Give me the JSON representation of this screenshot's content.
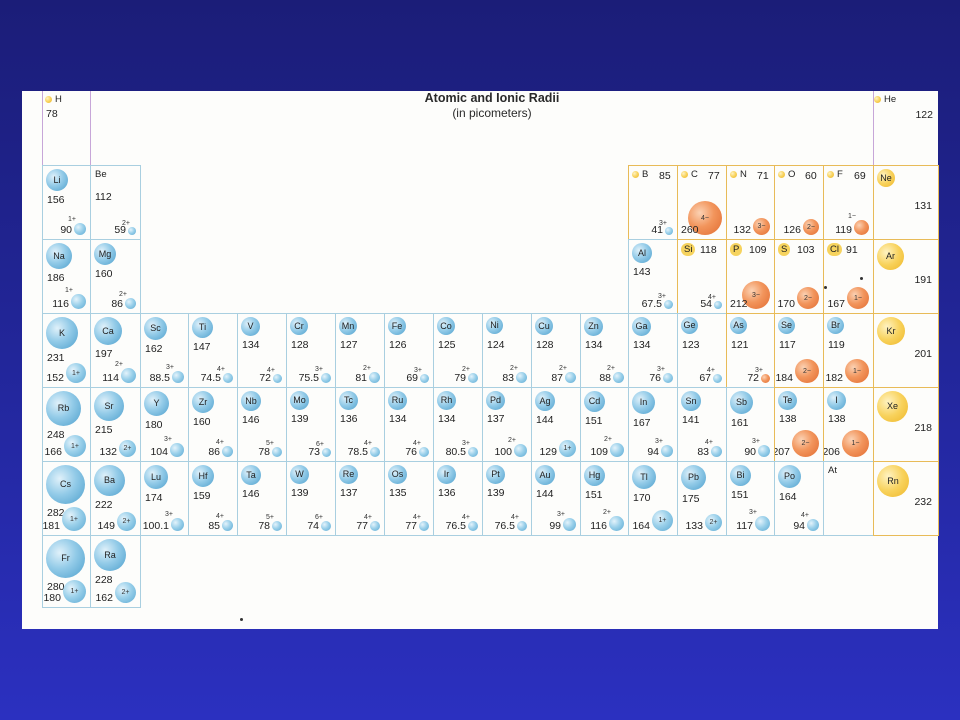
{
  "title": "Atomic and Ionic Radii",
  "subtitle": "(in picometers)",
  "colors": {
    "background": "#22269a",
    "cation": "#6db4dc",
    "anion": "#f08a52",
    "noble_gas": "#f5cf55",
    "cell_border": "#a9cfe0"
  },
  "elements": [
    {
      "symbol": "H",
      "atomic_radius": "78",
      "style": "small"
    },
    {
      "symbol": "He",
      "atomic_radius": "122",
      "style": "small-right"
    },
    {
      "symbol": "Li",
      "atomic_radius": "156",
      "ion_radius": "90",
      "charge": "1+",
      "ion_type": "cation"
    },
    {
      "symbol": "Be",
      "atomic_radius": "112",
      "ion_radius": "59",
      "charge": "2+",
      "ion_type": "cation",
      "style": "text"
    },
    {
      "symbol": "B",
      "atomic_radius": "85",
      "ion_radius": "41",
      "charge": "3+",
      "ion_type": "cation",
      "style": "small"
    },
    {
      "symbol": "C",
      "atomic_radius": "77",
      "ion_radius": "260",
      "charge": "4−",
      "ion_type": "anion",
      "style": "small"
    },
    {
      "symbol": "N",
      "atomic_radius": "71",
      "ion_radius": "132",
      "charge": "3−",
      "ion_type": "anion",
      "style": "small"
    },
    {
      "symbol": "O",
      "atomic_radius": "60",
      "ion_radius": "126",
      "charge": "2−",
      "ion_type": "anion",
      "style": "small"
    },
    {
      "symbol": "F",
      "atomic_radius": "69",
      "ion_radius": "119",
      "charge": "1−",
      "ion_type": "anion",
      "style": "small"
    },
    {
      "symbol": "Ne",
      "atomic_radius": "131",
      "style": "noble"
    },
    {
      "symbol": "Na",
      "atomic_radius": "186",
      "ion_radius": "116",
      "charge": "1+",
      "ion_type": "cation"
    },
    {
      "symbol": "Mg",
      "atomic_radius": "160",
      "ion_radius": "86",
      "charge": "2+",
      "ion_type": "cation"
    },
    {
      "symbol": "Al",
      "atomic_radius": "143",
      "ion_radius": "67.5",
      "charge": "3+",
      "ion_type": "cation"
    },
    {
      "symbol": "Si",
      "atomic_radius": "118",
      "ion_radius": "54",
      "charge": "4+",
      "ion_type": "cation",
      "style": "inline"
    },
    {
      "symbol": "P",
      "atomic_radius": "109",
      "ion_radius": "212",
      "charge": "3−",
      "ion_type": "anion",
      "style": "inline"
    },
    {
      "symbol": "S",
      "atomic_radius": "103",
      "ion_radius": "170",
      "charge": "2−",
      "ion_type": "anion",
      "style": "inline"
    },
    {
      "symbol": "Cl",
      "atomic_radius": "91",
      "ion_radius": "167",
      "charge": "1−",
      "ion_type": "anion",
      "style": "inline"
    },
    {
      "symbol": "Ar",
      "atomic_radius": "191",
      "style": "noble"
    },
    {
      "symbol": "K",
      "atomic_radius": "231",
      "ion_radius": "152",
      "charge": "1+",
      "ion_type": "cation"
    },
    {
      "symbol": "Ca",
      "atomic_radius": "197",
      "ion_radius": "114",
      "charge": "2+",
      "ion_type": "cation"
    },
    {
      "symbol": "Sc",
      "atomic_radius": "162",
      "ion_radius": "88.5",
      "charge": "3+",
      "ion_type": "cation"
    },
    {
      "symbol": "Ti",
      "atomic_radius": "147",
      "ion_radius": "74.5",
      "charge": "4+",
      "ion_type": "cation"
    },
    {
      "symbol": "V",
      "atomic_radius": "134",
      "ion_radius": "72",
      "charge": "4+",
      "ion_type": "cation"
    },
    {
      "symbol": "Cr",
      "atomic_radius": "128",
      "ion_radius": "75.5",
      "charge": "3+",
      "ion_type": "cation"
    },
    {
      "symbol": "Mn",
      "atomic_radius": "127",
      "ion_radius": "81",
      "charge": "2+",
      "ion_type": "cation"
    },
    {
      "symbol": "Fe",
      "atomic_radius": "126",
      "ion_radius": "69",
      "charge": "3+",
      "ion_type": "cation"
    },
    {
      "symbol": "Co",
      "atomic_radius": "125",
      "ion_radius": "79",
      "charge": "2+",
      "ion_type": "cation"
    },
    {
      "symbol": "Ni",
      "atomic_radius": "124",
      "ion_radius": "83",
      "charge": "2+",
      "ion_type": "cation"
    },
    {
      "symbol": "Cu",
      "atomic_radius": "128",
      "ion_radius": "87",
      "charge": "2+",
      "ion_type": "cation"
    },
    {
      "symbol": "Zn",
      "atomic_radius": "134",
      "ion_radius": "88",
      "charge": "2+",
      "ion_type": "cation"
    },
    {
      "symbol": "Ga",
      "atomic_radius": "134",
      "ion_radius": "76",
      "charge": "3+",
      "ion_type": "cation"
    },
    {
      "symbol": "Ge",
      "atomic_radius": "123",
      "ion_radius": "67",
      "charge": "4+",
      "ion_type": "cation"
    },
    {
      "symbol": "As",
      "atomic_radius": "121",
      "ion_radius": "72",
      "charge": "3+",
      "ion_type": "anion"
    },
    {
      "symbol": "Se",
      "atomic_radius": "117",
      "ion_radius": "184",
      "charge": "2−",
      "ion_type": "anion"
    },
    {
      "symbol": "Br",
      "atomic_radius": "119",
      "ion_radius": "182",
      "charge": "1−",
      "ion_type": "anion"
    },
    {
      "symbol": "Kr",
      "atomic_radius": "201",
      "style": "noble"
    },
    {
      "symbol": "Rb",
      "atomic_radius": "248",
      "ion_radius": "166",
      "charge": "1+",
      "ion_type": "cation"
    },
    {
      "symbol": "Sr",
      "atomic_radius": "215",
      "ion_radius": "132",
      "charge": "2+",
      "ion_type": "cation"
    },
    {
      "symbol": "Y",
      "atomic_radius": "180",
      "ion_radius": "104",
      "charge": "3+",
      "ion_type": "cation"
    },
    {
      "symbol": "Zr",
      "atomic_radius": "160",
      "ion_radius": "86",
      "charge": "4+",
      "ion_type": "cation"
    },
    {
      "symbol": "Nb",
      "atomic_radius": "146",
      "ion_radius": "78",
      "charge": "5+",
      "ion_type": "cation"
    },
    {
      "symbol": "Mo",
      "atomic_radius": "139",
      "ion_radius": "73",
      "charge": "6+",
      "ion_type": "cation"
    },
    {
      "symbol": "Tc",
      "atomic_radius": "136",
      "ion_radius": "78.5",
      "charge": "4+",
      "ion_type": "cation"
    },
    {
      "symbol": "Ru",
      "atomic_radius": "134",
      "ion_radius": "76",
      "charge": "4+",
      "ion_type": "cation"
    },
    {
      "symbol": "Rh",
      "atomic_radius": "134",
      "ion_radius": "80.5",
      "charge": "3+",
      "ion_type": "cation"
    },
    {
      "symbol": "Pd",
      "atomic_radius": "137",
      "ion_radius": "100",
      "charge": "2+",
      "ion_type": "cation"
    },
    {
      "symbol": "Ag",
      "atomic_radius": "144",
      "ion_radius": "129",
      "charge": "1+",
      "ion_type": "cation"
    },
    {
      "symbol": "Cd",
      "atomic_radius": "151",
      "ion_radius": "109",
      "charge": "2+",
      "ion_type": "cation"
    },
    {
      "symbol": "In",
      "atomic_radius": "167",
      "ion_radius": "94",
      "charge": "3+",
      "ion_type": "cation"
    },
    {
      "symbol": "Sn",
      "atomic_radius": "141",
      "ion_radius": "83",
      "charge": "4+",
      "ion_type": "cation"
    },
    {
      "symbol": "Sb",
      "atomic_radius": "161",
      "ion_radius": "90",
      "charge": "3+",
      "ion_type": "cation"
    },
    {
      "symbol": "Te",
      "atomic_radius": "138",
      "ion_radius": "207",
      "charge": "2−",
      "ion_type": "anion"
    },
    {
      "symbol": "I",
      "atomic_radius": "138",
      "ion_radius": "206",
      "charge": "1−",
      "ion_type": "anion"
    },
    {
      "symbol": "Xe",
      "atomic_radius": "218",
      "style": "noble"
    },
    {
      "symbol": "Cs",
      "atomic_radius": "282",
      "ion_radius": "181",
      "charge": "1+",
      "ion_type": "cation"
    },
    {
      "symbol": "Ba",
      "atomic_radius": "222",
      "ion_radius": "149",
      "charge": "2+",
      "ion_type": "cation"
    },
    {
      "symbol": "Lu",
      "atomic_radius": "174",
      "ion_radius": "100.1",
      "charge": "3+",
      "ion_type": "cation"
    },
    {
      "symbol": "Hf",
      "atomic_radius": "159",
      "ion_radius": "85",
      "charge": "4+",
      "ion_type": "cation"
    },
    {
      "symbol": "Ta",
      "atomic_radius": "146",
      "ion_radius": "78",
      "charge": "5+",
      "ion_type": "cation"
    },
    {
      "symbol": "W",
      "atomic_radius": "139",
      "ion_radius": "74",
      "charge": "6+",
      "ion_type": "cation"
    },
    {
      "symbol": "Re",
      "atomic_radius": "137",
      "ion_radius": "77",
      "charge": "4+",
      "ion_type": "cation"
    },
    {
      "symbol": "Os",
      "atomic_radius": "135",
      "ion_radius": "77",
      "charge": "4+",
      "ion_type": "cation"
    },
    {
      "symbol": "Ir",
      "atomic_radius": "136",
      "ion_radius": "76.5",
      "charge": "4+",
      "ion_type": "cation"
    },
    {
      "symbol": "Pt",
      "atomic_radius": "139",
      "ion_radius": "76.5",
      "charge": "4+",
      "ion_type": "cation"
    },
    {
      "symbol": "Au",
      "atomic_radius": "144",
      "ion_radius": "99",
      "charge": "3+",
      "ion_type": "cation"
    },
    {
      "symbol": "Hg",
      "atomic_radius": "151",
      "ion_radius": "116",
      "charge": "2+",
      "ion_type": "cation"
    },
    {
      "symbol": "Tl",
      "atomic_radius": "170",
      "ion_radius": "164",
      "charge": "1+",
      "ion_type": "cation"
    },
    {
      "symbol": "Pb",
      "atomic_radius": "175",
      "ion_radius": "133",
      "charge": "2+",
      "ion_type": "cation"
    },
    {
      "symbol": "Bi",
      "atomic_radius": "151",
      "ion_radius": "117",
      "charge": "3+",
      "ion_type": "cation"
    },
    {
      "symbol": "Po",
      "atomic_radius": "164",
      "ion_radius": "94",
      "charge": "4+",
      "ion_type": "cation"
    },
    {
      "symbol": "At",
      "style": "plain"
    },
    {
      "symbol": "Rn",
      "atomic_radius": "232",
      "style": "noble"
    },
    {
      "symbol": "Fr",
      "atomic_radius": "280",
      "ion_radius": "180",
      "charge": "1+",
      "ion_type": "cation"
    },
    {
      "symbol": "Ra",
      "atomic_radius": "228",
      "ion_radius": "162",
      "charge": "2+",
      "ion_type": "cation"
    }
  ]
}
